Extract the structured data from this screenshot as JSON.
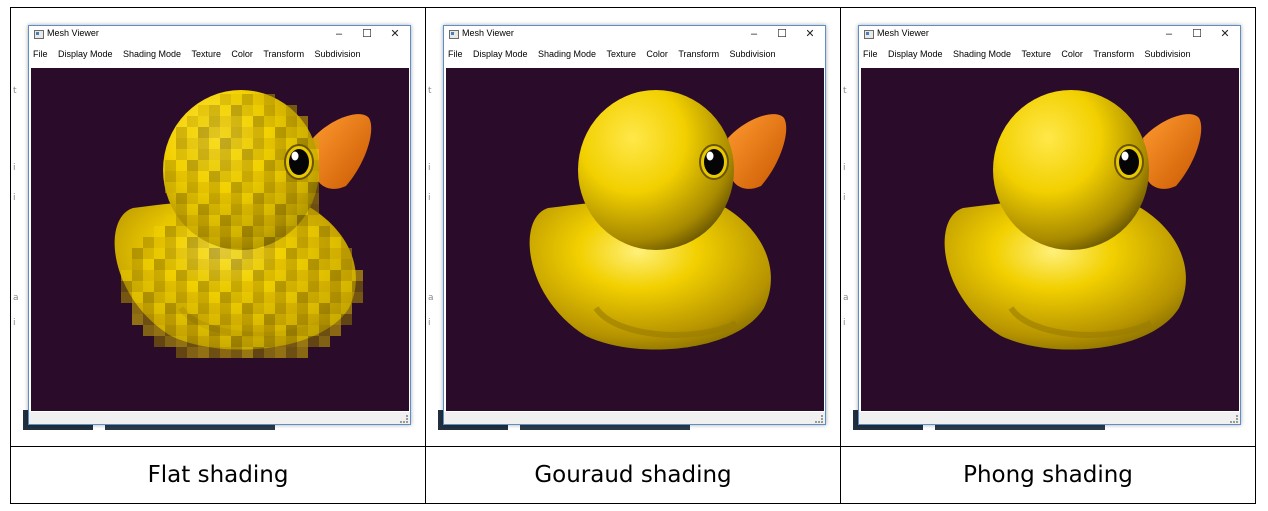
{
  "window": {
    "title": "Mesh Viewer",
    "controls": {
      "minimize": "–",
      "maximize": "☐",
      "close": "✕"
    },
    "menu": [
      "File",
      "Display Mode",
      "Shading Mode",
      "Texture",
      "Color",
      "Transform",
      "Subdivision"
    ]
  },
  "panels": [
    {
      "caption": "Flat shading",
      "shading": "flat"
    },
    {
      "caption": "Gouraud shading",
      "shading": "gouraud"
    },
    {
      "caption": "Phong shading",
      "shading": "phong"
    }
  ],
  "colors": {
    "viewport_bg": "#2a0b2a",
    "duck_yellow": "#f2d000",
    "duck_shadow": "#8a7000",
    "beak": "#f07a10",
    "window_border": "#5a8fc7"
  },
  "background_fragments": [
    "t",
    "i",
    "i",
    "a",
    "i"
  ]
}
